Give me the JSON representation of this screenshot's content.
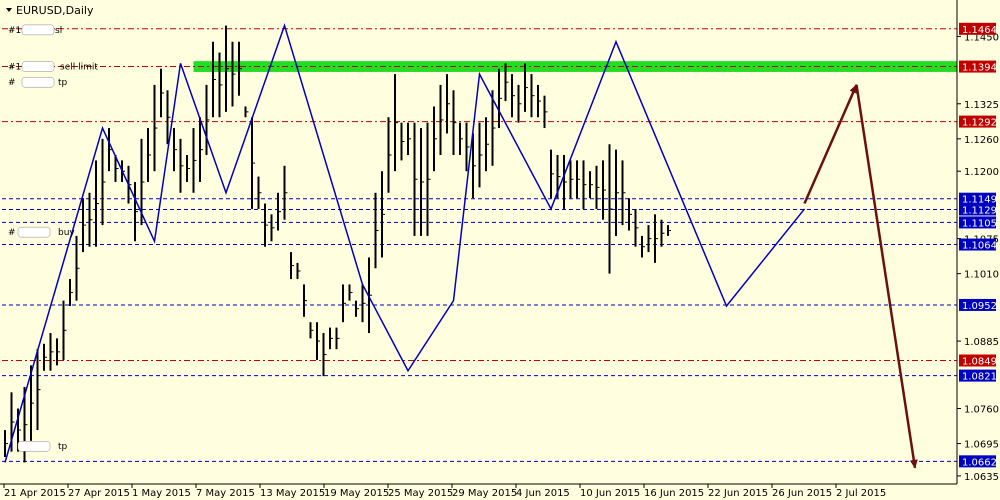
{
  "chart_data": {
    "type": "bar",
    "title": "EURUSD,Daily",
    "ylim": [
      1.062,
      1.151
    ],
    "grid": false,
    "colors": {
      "background": "#ffffe0",
      "bars": "#000000",
      "zigzag": "#0000c0",
      "red_level": "#c00000",
      "blue_level": "#0000c0",
      "projection": "#6b0f0f",
      "zone": "#22dd22"
    },
    "y_ticks": [
      "1.1450",
      "1.1325",
      "1.1260",
      "1.1200",
      "1.1075",
      "1.1010",
      "1.0885",
      "1.0760",
      "1.0695",
      "1.0635"
    ],
    "x_ticks": [
      "21 Apr 2015",
      "27 Apr 2015",
      "1 May 2015",
      "7 May 2015",
      "13 May 2015",
      "19 May 2015",
      "25 May 2015",
      "29 May 2015",
      "4 Jun 2015",
      "10 Jun 2015",
      "16 Jun 2015",
      "22 Jun 2015",
      "26 Jun 2015",
      "2 Jul 2015"
    ],
    "price_tags": [
      {
        "label": "1.1464",
        "color": "red"
      },
      {
        "label": "1.1394",
        "color": "red"
      },
      {
        "label": "1.1292",
        "color": "red"
      },
      {
        "label": "1.1149",
        "color": "blue"
      },
      {
        "label": "1.1129",
        "color": "blue"
      },
      {
        "label": "1.1105",
        "color": "blue"
      },
      {
        "label": "1.1064",
        "color": "blue"
      },
      {
        "label": "1.0952",
        "color": "blue"
      },
      {
        "label": "1.0849",
        "color": "red"
      },
      {
        "label": "1.0821",
        "color": "blue"
      },
      {
        "label": "1.0662",
        "color": "blue"
      }
    ],
    "order_labels": [
      {
        "text": "#1",
        "suffix": "sl"
      },
      {
        "text": "#1",
        "suffix": "sell limit"
      },
      {
        "text": "#",
        "suffix": "tp"
      },
      {
        "text": "#",
        "suffix": "buy"
      },
      {
        "text": "",
        "suffix": "tp"
      }
    ],
    "bars": [
      [
        1.072,
        1.067
      ],
      [
        1.079,
        1.068
      ],
      [
        1.076,
        1.068
      ],
      [
        1.08,
        1.066
      ],
      [
        1.084,
        1.07
      ],
      [
        1.087,
        1.072
      ],
      [
        1.088,
        1.083
      ],
      [
        1.09,
        1.083
      ],
      [
        1.089,
        1.084
      ],
      [
        1.096,
        1.085
      ],
      [
        1.1,
        1.095
      ],
      [
        1.108,
        1.096
      ],
      [
        1.115,
        1.105
      ],
      [
        1.116,
        1.106
      ],
      [
        1.122,
        1.106
      ],
      [
        1.126,
        1.11
      ],
      [
        1.128,
        1.12
      ],
      [
        1.123,
        1.118
      ],
      [
        1.122,
        1.118
      ],
      [
        1.121,
        1.114
      ],
      [
        1.118,
        1.107
      ],
      [
        1.126,
        1.11
      ],
      [
        1.128,
        1.118
      ],
      [
        1.136,
        1.12
      ],
      [
        1.139,
        1.13
      ],
      [
        1.135,
        1.125
      ],
      [
        1.128,
        1.12
      ],
      [
        1.126,
        1.116
      ],
      [
        1.123,
        1.118
      ],
      [
        1.128,
        1.116
      ],
      [
        1.13,
        1.118
      ],
      [
        1.136,
        1.123
      ],
      [
        1.144,
        1.13
      ],
      [
        1.142,
        1.13
      ],
      [
        1.147,
        1.131
      ],
      [
        1.144,
        1.132
      ],
      [
        1.144,
        1.134
      ],
      [
        1.132,
        1.13
      ],
      [
        1.13,
        1.113
      ],
      [
        1.119,
        1.113
      ],
      [
        1.114,
        1.106
      ],
      [
        1.112,
        1.107
      ],
      [
        1.116,
        1.109
      ],
      [
        1.121,
        1.111
      ],
      [
        1.105,
        1.1
      ],
      [
        1.103,
        1.1
      ],
      [
        1.099,
        1.093
      ],
      [
        1.092,
        1.089
      ],
      [
        1.092,
        1.085
      ],
      [
        1.09,
        1.082
      ],
      [
        1.091,
        1.087
      ],
      [
        1.091,
        1.087
      ],
      [
        1.099,
        1.092
      ],
      [
        1.099,
        1.096
      ],
      [
        1.096,
        1.093
      ],
      [
        1.099,
        1.092
      ],
      [
        1.104,
        1.09
      ],
      [
        1.116,
        1.102
      ],
      [
        1.12,
        1.104
      ],
      [
        1.13,
        1.116
      ],
      [
        1.138,
        1.12
      ],
      [
        1.129,
        1.122
      ],
      [
        1.129,
        1.123
      ],
      [
        1.129,
        1.108
      ],
      [
        1.128,
        1.108
      ],
      [
        1.129,
        1.108
      ],
      [
        1.132,
        1.12
      ],
      [
        1.136,
        1.123
      ],
      [
        1.138,
        1.127
      ],
      [
        1.135,
        1.123
      ],
      [
        1.129,
        1.123
      ],
      [
        1.129,
        1.12
      ],
      [
        1.127,
        1.115
      ],
      [
        1.129,
        1.117
      ],
      [
        1.13,
        1.12
      ],
      [
        1.135,
        1.121
      ],
      [
        1.139,
        1.128
      ],
      [
        1.14,
        1.133
      ],
      [
        1.138,
        1.13
      ],
      [
        1.136,
        1.129
      ],
      [
        1.14,
        1.131
      ],
      [
        1.138,
        1.13
      ],
      [
        1.136,
        1.13
      ],
      [
        1.134,
        1.128
      ],
      [
        1.124,
        1.115
      ],
      [
        1.123,
        1.115
      ],
      [
        1.123,
        1.113
      ],
      [
        1.122,
        1.115
      ],
      [
        1.122,
        1.115
      ],
      [
        1.122,
        1.113
      ],
      [
        1.12,
        1.115
      ],
      [
        1.121,
        1.113
      ],
      [
        1.122,
        1.111
      ],
      [
        1.125,
        1.101
      ],
      [
        1.124,
        1.108
      ],
      [
        1.122,
        1.11
      ],
      [
        1.115,
        1.109
      ],
      [
        1.113,
        1.106
      ],
      [
        1.108,
        1.104
      ],
      [
        1.11,
        1.105
      ],
      [
        1.112,
        1.103
      ],
      [
        1.111,
        1.106
      ],
      [
        1.11,
        1.108
      ]
    ],
    "zigzag": [
      [
        0,
        1.066
      ],
      [
        15,
        1.128
      ],
      [
        23,
        1.107
      ],
      [
        27,
        1.14
      ],
      [
        34,
        1.116
      ],
      [
        43,
        1.147
      ],
      [
        55,
        1.099
      ],
      [
        62,
        1.083
      ],
      [
        69,
        1.096
      ],
      [
        73,
        1.138
      ],
      [
        84,
        1.113
      ],
      [
        94,
        1.144
      ],
      [
        111,
        1.095
      ],
      [
        123,
        1.113
      ]
    ],
    "projection": [
      [
        123,
        1.114
      ],
      [
        131,
        1.136
      ],
      [
        140,
        1.065
      ]
    ]
  }
}
